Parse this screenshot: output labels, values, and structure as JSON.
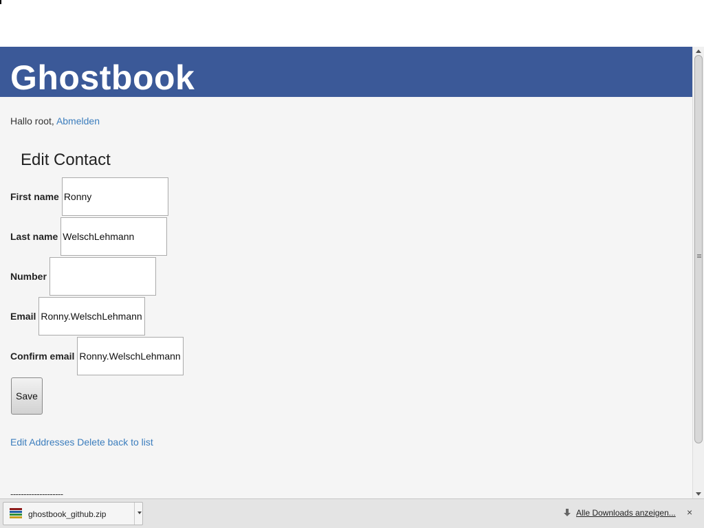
{
  "app": {
    "site_title": "Ghostbook"
  },
  "greeting": {
    "prefix": "Hallo root, ",
    "logout_label": "Abmelden"
  },
  "form": {
    "title": "Edit Contact",
    "fields": [
      {
        "label": "First name",
        "value": "Ronny"
      },
      {
        "label": "Last name",
        "value": "WelschLehmann"
      },
      {
        "label": "Number",
        "value": ""
      },
      {
        "label": "Email",
        "value": "Ronny.WelschLehmann"
      },
      {
        "label": "Confirm email",
        "value": "Ronny.WelschLehmann"
      }
    ],
    "save_label": "Save"
  },
  "links": {
    "edit_addresses": "Edit Addresses",
    "delete": "Delete",
    "back": "back to list"
  },
  "footer": {
    "separator": "--------------------"
  },
  "download_bar": {
    "file_name": "ghostbook_github.zip",
    "file_icon": "archive-icon",
    "show_all_label": "Alle Downloads anzeigen...",
    "close_label": "×"
  },
  "colors": {
    "header_bg": "#3b5998",
    "link": "#3b7dbd",
    "page_bg": "#f5f5f5"
  }
}
